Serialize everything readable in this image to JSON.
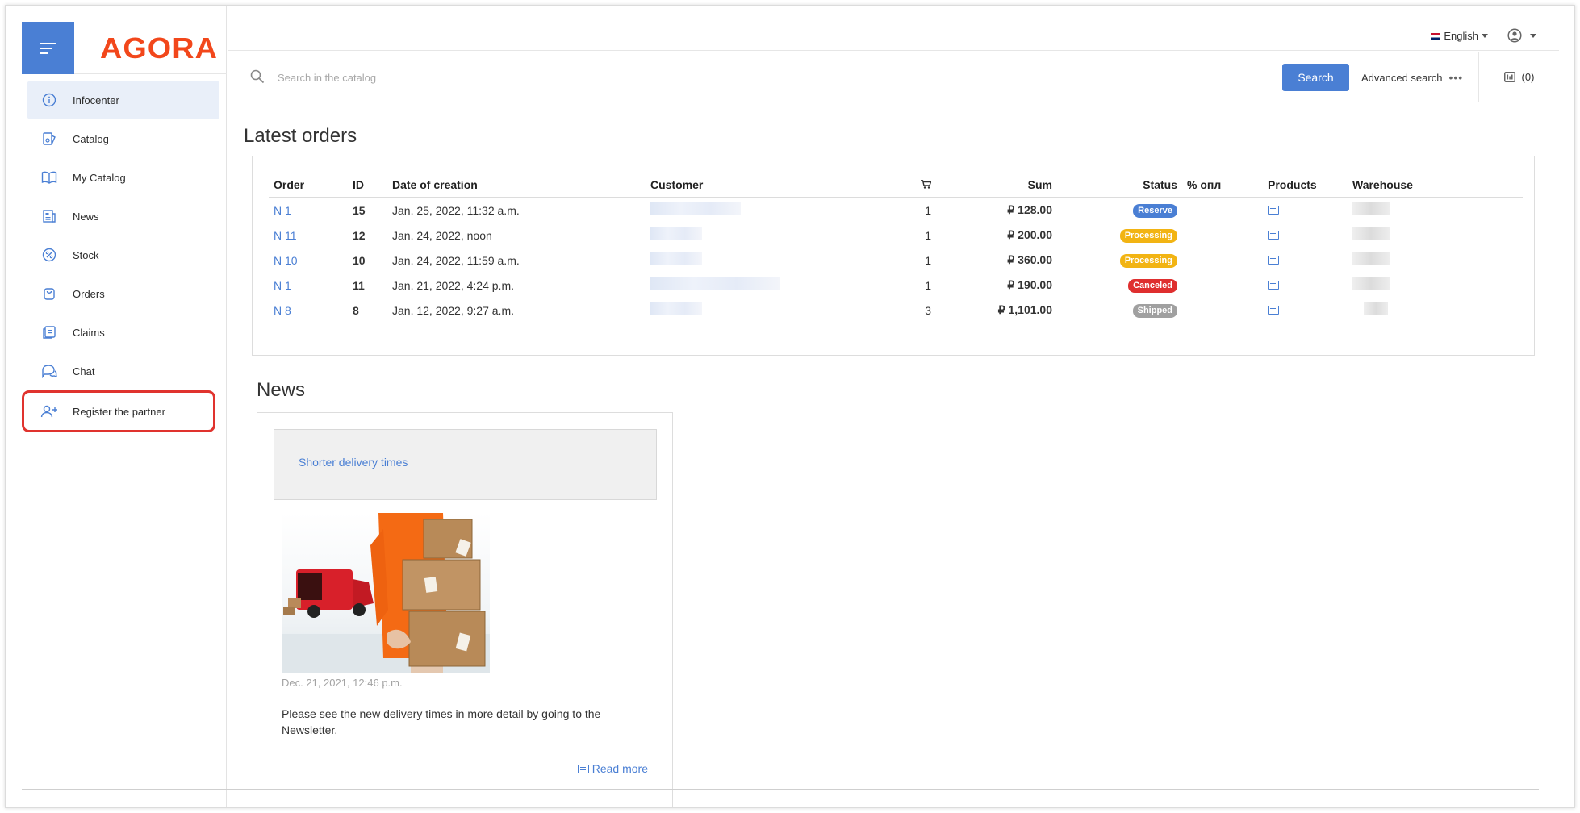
{
  "app": {
    "logo_text": "AGORA",
    "accent": "#4a7fd4",
    "logo_color": "#f2471b"
  },
  "sidebar": {
    "items": [
      {
        "label": "Infocenter",
        "icon": "info-icon",
        "active": true
      },
      {
        "label": "Catalog",
        "icon": "catalog-icon"
      },
      {
        "label": "My Catalog",
        "icon": "book-icon"
      },
      {
        "label": "News",
        "icon": "news-icon"
      },
      {
        "label": "Stock",
        "icon": "percent-icon"
      },
      {
        "label": "Orders",
        "icon": "bag-icon"
      },
      {
        "label": "Claims",
        "icon": "claims-icon"
      },
      {
        "label": "Chat",
        "icon": "chat-icon"
      },
      {
        "label": "Register the partner",
        "icon": "add-user-icon",
        "highlighted": true
      }
    ]
  },
  "topbar": {
    "language": "English"
  },
  "search": {
    "placeholder": "Search in the catalog",
    "button_label": "Search",
    "advanced_label": "Advanced search",
    "advanced_dots": "•••",
    "compare_count": "(0)"
  },
  "latest_orders": {
    "title": "Latest orders",
    "columns": {
      "order": "Order",
      "id": "ID",
      "date": "Date of creation",
      "customer": "Customer",
      "sum": "Sum",
      "status": "Status",
      "paid": "% опл",
      "products": "Products",
      "warehouse": "Warehouse"
    },
    "rows": [
      {
        "order": "N 1",
        "id": "15",
        "date": "Jan. 25, 2022, 11:32 a.m.",
        "qty": "1",
        "sum": "₽ 128.00",
        "status": "Reserve",
        "status_color": "#4a7fd4"
      },
      {
        "order": "N 11",
        "id": "12",
        "date": "Jan. 24, 2022, noon",
        "qty": "1",
        "sum": "₽ 200.00",
        "status": "Processing",
        "status_color": "#f2b413"
      },
      {
        "order": "N 10",
        "id": "10",
        "date": "Jan. 24, 2022, 11:59 a.m.",
        "qty": "1",
        "sum": "₽ 360.00",
        "status": "Processing",
        "status_color": "#f2b413"
      },
      {
        "order": "N 1",
        "id": "11",
        "date": "Jan. 21, 2022, 4:24 p.m.",
        "qty": "1",
        "sum": "₽ 190.00",
        "status": "Canceled",
        "status_color": "#df2f2f"
      },
      {
        "order": "N 8",
        "id": "8",
        "date": "Jan. 12, 2022, 9:27 a.m.",
        "qty": "3",
        "sum": "₽ 1,101.00",
        "status": "Shipped",
        "status_color": "#a0a0a0"
      }
    ]
  },
  "news": {
    "title": "News",
    "item": {
      "headline": "Shorter delivery times",
      "date": "Dec. 21, 2021, 12:46 p.m.",
      "text": "Please see the new delivery times in more detail by going to the Newsletter.",
      "read_more": "Read more"
    }
  }
}
